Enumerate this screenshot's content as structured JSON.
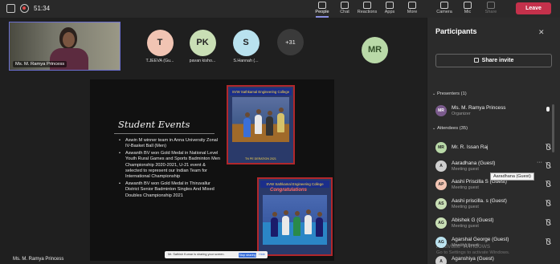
{
  "topbar": {
    "timer": "51:34",
    "tools": [
      "People",
      "Chat",
      "Reactions",
      "Apps",
      "More",
      "Camera",
      "Mic",
      "Share"
    ],
    "leave_label": "Leave"
  },
  "self_tile": {
    "name": "Ms. M. Ramya Princess"
  },
  "tiles": [
    {
      "initials": "T",
      "name": "T.JEEVA (Gu...",
      "color": "#f1c4b3"
    },
    {
      "initials": "PK",
      "name": "pavan kisho...",
      "color": "#c9dfb5"
    },
    {
      "initials": "S",
      "name": "S.Hannah (...",
      "color": "#b9e2ef"
    }
  ],
  "more_count": "+31",
  "mr_tile": {
    "initials": "MR",
    "color": "#b9d9a8"
  },
  "slide": {
    "title": "Student Events",
    "bullets": [
      "Aswin M winner team in Anna University Zonal IV-Basket Ball (Men)",
      "Aswanth BV won Gold Medal in National Level Youth Rural Games and Sports Badminton Men Championship 2020-2021, U-21 event & selected to represent our Indian Team for International Championship",
      "Aswanth BV won Gold Medal in Thiruvallur District Senior Badminton Singles And Mixed Doubles Championship 2021"
    ],
    "photo1_header": "SVW Sathkamal Engineering College",
    "photo1_caption": "TN PE DERATION 2021",
    "photo2_header": "SVW Sathkamal Engineering College",
    "photo2_caption": "Congratulations"
  },
  "presenter_name": "Ms. M. Ramya Princess",
  "share_bar": {
    "text": "Mr. Sathish Kumar is sharing your screen.",
    "button": "Stop sharing",
    "hide": "Hide"
  },
  "participants": {
    "title": "Participants",
    "invite_label": "Share invite",
    "presenters_label": "Presenters (1)",
    "attendees_label": "Attendees (35)",
    "presenters": [
      {
        "name": "Ms. M. Ramya Princess",
        "role": "Organizer",
        "initials": "MR",
        "color": "#7a5a8c",
        "mic": "on"
      }
    ],
    "attendees": [
      {
        "name": "Mr. R. Issan Raj",
        "role": "",
        "initials": "MR",
        "color": "#b9d9a8"
      },
      {
        "name": "Aaradhana (Guest)",
        "role": "Meeting guest",
        "initials": "A",
        "color": "#cfcfcf"
      },
      {
        "name": "Aashi Priscilla S (Guest)",
        "role": "Meeting guest",
        "initials": "AP",
        "color": "#f1c4b3"
      },
      {
        "name": "Aashi priscilla. s (Guest)",
        "role": "Meeting guest",
        "initials": "AS",
        "color": "#c9dfb5"
      },
      {
        "name": "Abishek G (Guest)",
        "role": "Meeting guest",
        "initials": "AG",
        "color": "#c9dfb5"
      },
      {
        "name": "Agarshal George (Guest)",
        "role": "Meeting guest",
        "initials": "AG",
        "color": "#b9e2ef"
      },
      {
        "name": "Aganshiya (Guest)",
        "role": "",
        "initials": "A",
        "color": "#cfcfcf"
      }
    ]
  },
  "tooltip": "Aaradhana (Guest)",
  "watermark": {
    "title": "Activate Windows",
    "sub": "Go to Settings to activate Windows."
  }
}
